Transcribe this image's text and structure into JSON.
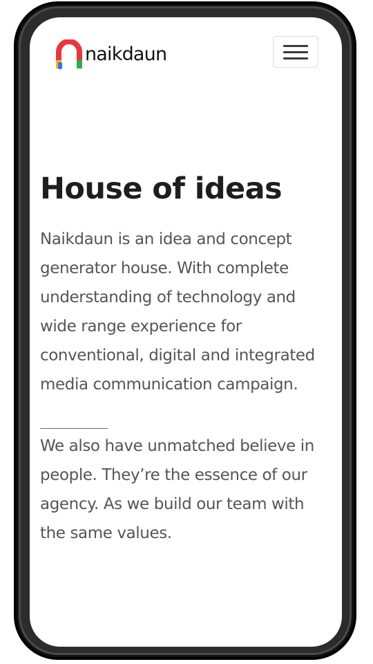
{
  "header": {
    "brand_name": "naikdaun",
    "logo_icon": "naikdaun-arch-logo-icon",
    "menu_icon": "hamburger-menu-icon"
  },
  "hero": {
    "title": "House of ideas",
    "paragraph_1": "Naikdaun is an idea and concept generator house. With complete understanding of technology and wide range experience for conventional, digital and integrated media communication campaign.",
    "separator": "________",
    "paragraph_2": "We also have unmatched believe in people. They’re the essence of our agency. As we build our team with the same values."
  },
  "colors": {
    "logo_red": "#e8383d",
    "logo_yellow": "#f6b41a",
    "logo_blue": "#2e7be4",
    "logo_green": "#35a853",
    "title_text": "#1e1e1e",
    "body_text": "#555555",
    "device_frame": "#000000"
  }
}
